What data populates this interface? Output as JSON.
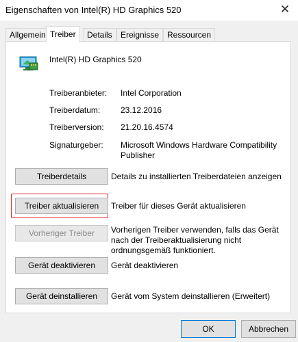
{
  "window": {
    "title": "Eigenschaften von Intel(R) HD Graphics 520"
  },
  "tabs": [
    {
      "label": "Allgemein"
    },
    {
      "label": "Treiber"
    },
    {
      "label": "Details"
    },
    {
      "label": "Ereignisse"
    },
    {
      "label": "Ressourcen"
    }
  ],
  "active_tab": "Treiber",
  "device": {
    "name": "Intel(R) HD Graphics 520",
    "icon": "display-adapter-icon"
  },
  "info": [
    {
      "label": "Treiberanbieter:",
      "value": "Intel Corporation"
    },
    {
      "label": "Treiberdatum:",
      "value": "23.12.2016"
    },
    {
      "label": "Treiberversion:",
      "value": "21.20.16.4574"
    },
    {
      "label": "Signaturgeber:",
      "value": "Microsoft Windows Hardware Compatibility Publisher"
    }
  ],
  "actions": [
    {
      "button": "Treiberdetails",
      "description": "Details zu installierten Treiberdateien anzeigen",
      "enabled": true
    },
    {
      "button": "Treiber aktualisieren",
      "description": "Treiber für dieses Gerät aktualisieren",
      "enabled": true,
      "highlighted": true
    },
    {
      "button": "Vorheriger Treiber",
      "description": "Vorherigen Treiber verwenden, falls das Gerät nach der Treiberaktualisierung nicht ordnungsgemäß funktioniert.",
      "enabled": false
    },
    {
      "button": "Gerät deaktivieren",
      "description": "Gerät deaktivieren",
      "enabled": true
    },
    {
      "button": "Gerät deinstallieren",
      "description": "Gerät vom System deinstallieren (Erweitert)",
      "enabled": true
    }
  ],
  "footer": {
    "ok": "OK",
    "cancel": "Abbrechen"
  },
  "colors": {
    "highlight": "#e02020",
    "panel": "#ffffff",
    "window": "#f0f0f0"
  }
}
